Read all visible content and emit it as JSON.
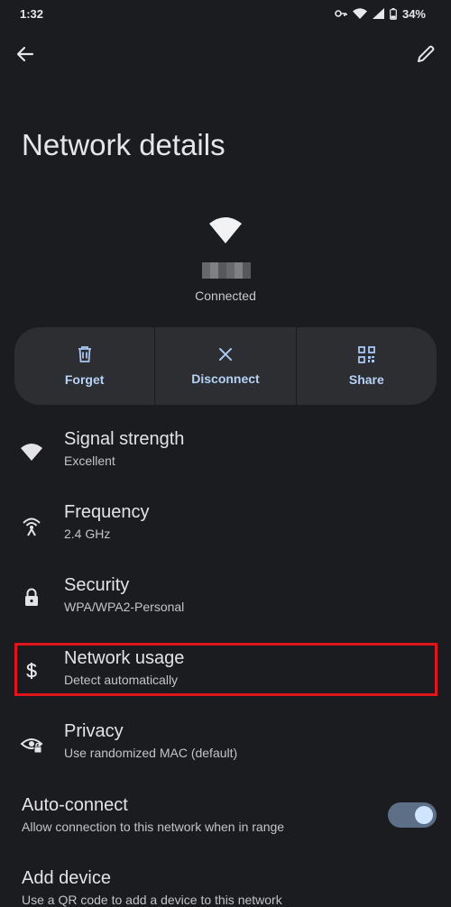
{
  "status_bar": {
    "time": "1:32",
    "battery": "34%",
    "icons": [
      "vpn-key-icon",
      "wifi-icon",
      "cellular-signal-icon",
      "battery-icon"
    ]
  },
  "toolbar": {
    "back_icon": "arrow-back-icon",
    "edit_icon": "pencil-icon"
  },
  "page": {
    "title": "Network details"
  },
  "network": {
    "icon": "wifi-icon",
    "status": "Connected"
  },
  "actions": [
    {
      "label": "Forget",
      "icon": "trash-icon"
    },
    {
      "label": "Disconnect",
      "icon": "close-icon"
    },
    {
      "label": "Share",
      "icon": "qr-code-icon"
    }
  ],
  "details": [
    {
      "title": "Signal strength",
      "value": "Excellent",
      "icon": "wifi-icon"
    },
    {
      "title": "Frequency",
      "value": "2.4 GHz",
      "icon": "broadcast-icon"
    },
    {
      "title": "Security",
      "value": "WPA/WPA2-Personal",
      "icon": "lock-icon"
    },
    {
      "title": "Network usage",
      "value": "Detect automatically",
      "icon": "dollar-icon"
    },
    {
      "title": "Privacy",
      "value": "Use randomized MAC (default)",
      "icon": "eye-lock-icon"
    }
  ],
  "auto_connect": {
    "title": "Auto-connect",
    "subtitle": "Allow connection to this network when in range",
    "enabled": true
  },
  "add_device": {
    "title": "Add device",
    "subtitle": "Use a QR code to add a device to this network"
  },
  "colors": {
    "background": "#1b1c1f",
    "card": "#2c2e31",
    "accent": "#b7d2f7",
    "highlight": "#e0141b",
    "toggle_track": "#5d6f86"
  }
}
